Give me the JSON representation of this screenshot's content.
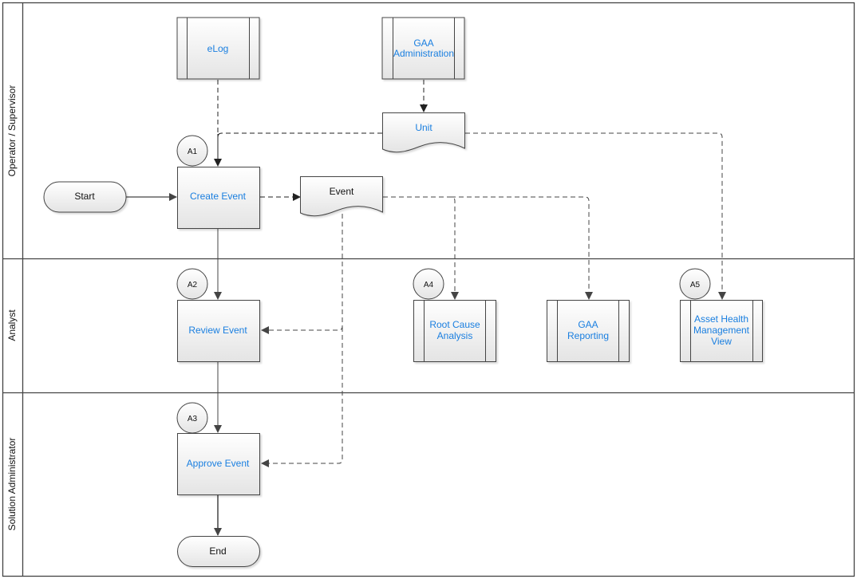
{
  "lanes": [
    {
      "label": "Operator / Supervisor"
    },
    {
      "label": "Analyst"
    },
    {
      "label": "Solution Administrator"
    }
  ],
  "nodes": {
    "start": {
      "label": "Start",
      "type": "terminator"
    },
    "end": {
      "label": "End",
      "type": "terminator"
    },
    "elog": {
      "lines": [
        "eLog"
      ],
      "type": "subprocess"
    },
    "gaa_admin": {
      "lines": [
        "GAA",
        "Administration"
      ],
      "type": "subprocess"
    },
    "unit": {
      "label": "Unit",
      "type": "document"
    },
    "event": {
      "label": "Event",
      "type": "document"
    },
    "create_event": {
      "label": "Create Event",
      "type": "process",
      "step": "A1"
    },
    "review_event": {
      "label": "Review Event",
      "type": "process",
      "step": "A2"
    },
    "approve_event": {
      "label": "Approve Event",
      "type": "process",
      "step": "A3"
    },
    "rca": {
      "lines": [
        "Root Cause",
        "Analysis"
      ],
      "type": "subprocess",
      "step": "A4"
    },
    "gaa_reporting": {
      "lines": [
        "GAA",
        "Reporting"
      ],
      "type": "subprocess"
    },
    "ahm_view": {
      "lines": [
        "Asset Health",
        "Management",
        "View"
      ],
      "type": "subprocess",
      "step": "A5"
    }
  },
  "colors": {
    "link_text": "#1a7fe0",
    "stroke": "#444444",
    "fill_top": "#ffffff",
    "fill_bottom": "#e6e6e6"
  }
}
